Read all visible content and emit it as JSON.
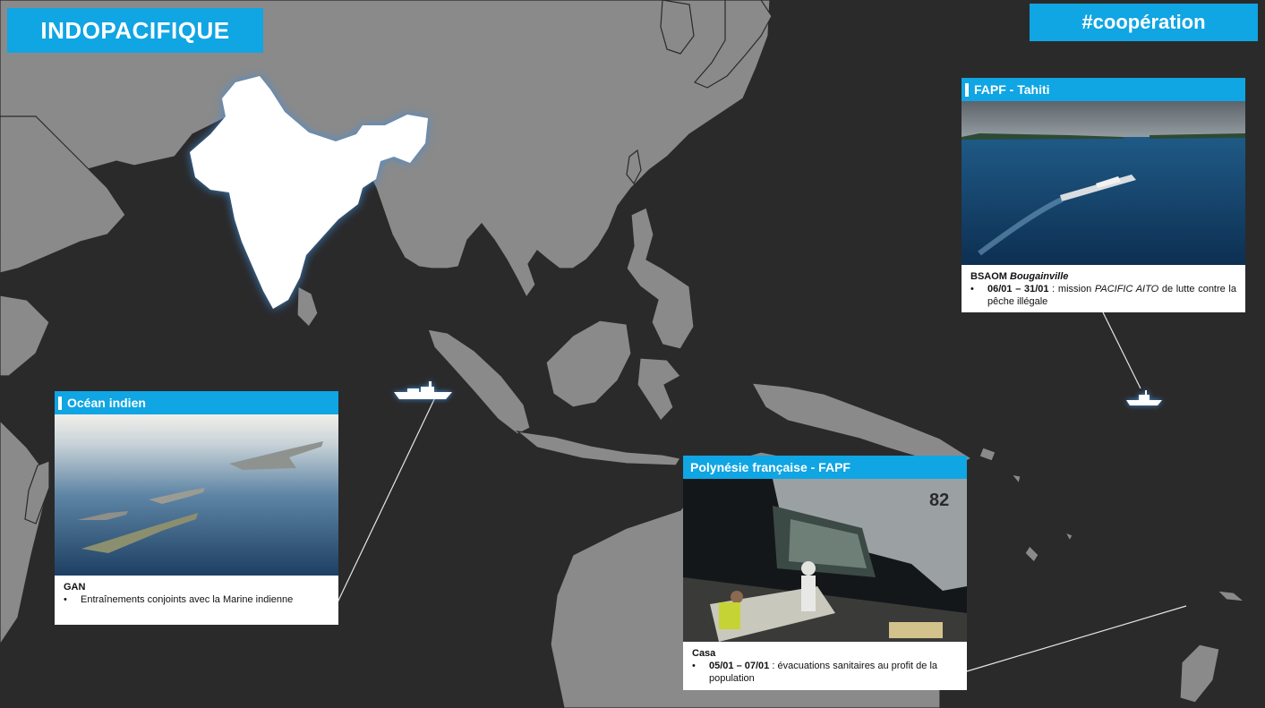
{
  "header": {
    "title": "INDOPACIFIQUE",
    "hashtag": "#coopération"
  },
  "cards": {
    "tahiti": {
      "title": "FAPF - Tahiti",
      "unit": "BSAOM",
      "unit_italic": "Bougainville",
      "date": "06/01 – 31/01",
      "text_a": " : mission ",
      "text_italic": "PACIFIC AITO",
      "text_b": " de lutte contre la pêche illégale"
    },
    "ocean": {
      "title": "Océan indien",
      "unit": "GAN",
      "text": "Entraînements conjoints avec la Marine indienne"
    },
    "polynesie": {
      "title": "Polynésie française - FAPF",
      "unit": "Casa",
      "date": "05/01 – 07/01",
      "text": " : évacuations sanitaires au profit de la population"
    }
  },
  "icons": [
    "ship-icon",
    "bullet-icon"
  ],
  "colors": {
    "accent": "#10a5e3",
    "background": "#2a2a2b",
    "land": "#8a8a8a",
    "highlight": "#ffffff"
  }
}
